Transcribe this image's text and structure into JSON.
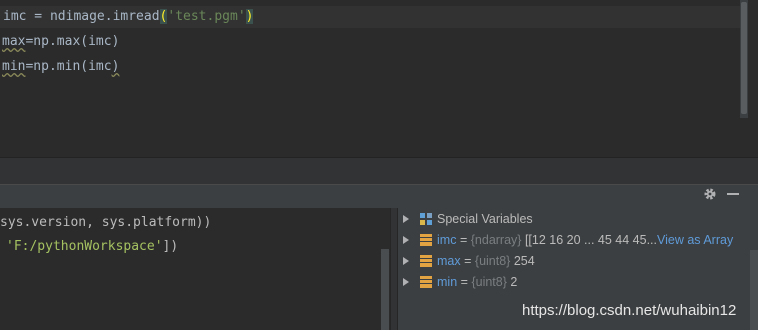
{
  "editor": {
    "line1": {
      "pre": "imc = ndimage.imread",
      "open_paren": "(",
      "string": "'test.pgm'",
      "close_paren": ")"
    },
    "line2": {
      "var": "max",
      "rest": "=np.max(imc)"
    },
    "line3": {
      "var": "min",
      "rest": "=np.min(imc",
      "close_paren": ")"
    }
  },
  "console": {
    "line1": "sys.version, sys.platform))",
    "line2": {
      "string": "'F:/pythonWorkspace'",
      "rest": "])"
    }
  },
  "variables": {
    "special": "Special Variables",
    "items": [
      {
        "name": "imc",
        "eq": "=",
        "type": "{ndarray}",
        "value": "[[12 16 20 ... 45 44 45...",
        "link": "View as Array"
      },
      {
        "name": "max",
        "eq": "=",
        "type": "{uint8}",
        "value": "254"
      },
      {
        "name": "min",
        "eq": "=",
        "type": "{uint8}",
        "value": "2"
      }
    ]
  },
  "watermark": "https://blog.csdn.net/wuhaibin12",
  "icons": [
    "gear-icon",
    "minimize-icon",
    "expand-arrow-icon",
    "special-variables-icon",
    "variable-icon"
  ]
}
